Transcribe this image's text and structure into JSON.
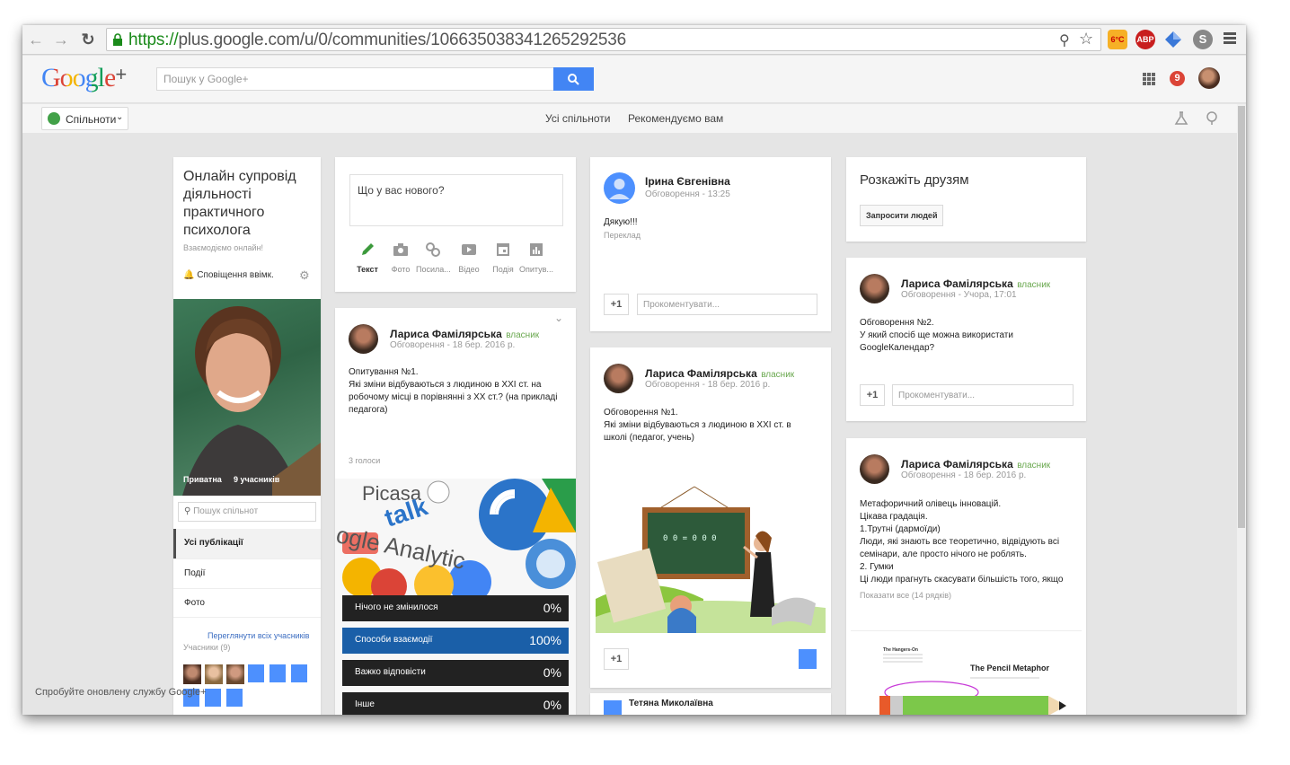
{
  "browser": {
    "url_secure": "https://",
    "url_rest": "plus.google.com/u/0/communities/106635038341265292536",
    "ext_weather": "6°C",
    "ext_abp": "ABP"
  },
  "gbar": {
    "logo_google": "Google",
    "logo_plus": "+",
    "search_placeholder": "Пошук у Google+",
    "notif_count": "9"
  },
  "cbar": {
    "dropdown_label": "Спільноти",
    "link_all": "Усі спільноти",
    "link_recommended": "Рекомендуємо вам"
  },
  "community": {
    "title": "Онлайн супровід діяльності практичного психолога",
    "tagline": "Взаємодіємо онлайн!",
    "notifications": "Сповіщення ввімк.",
    "privacy": "Приватна",
    "members_count": "9 учасників",
    "search_placeholder": "Пошук спільнот",
    "nav": [
      "Усі публікації",
      "Події",
      "Фото"
    ],
    "view_members": "Переглянути всіх учасників",
    "members_label": "Учасники (9)"
  },
  "composer": {
    "prompt": "Що у вас нового?",
    "tools": [
      "Текст",
      "Фото",
      "Посила...",
      "Відео",
      "Подія",
      "Опитув..."
    ]
  },
  "post_poll": {
    "author": "Лариса Фамілярська",
    "badge": "власник",
    "category": "Обговорення",
    "date": "18 бер. 2016 р.",
    "text": "Опитування №1.\nЯкі зміни відбуваються з людиною в XXI ст. на робочому місці  в порівнянні з XX ст.? (на прикладі педагога)",
    "votes": "3 голоси",
    "image_words": [
      "Picasa",
      "talk",
      "ogle Analytic",
      "Google"
    ],
    "options": [
      {
        "label": "Нічого не змінилося",
        "percent": "0%"
      },
      {
        "label": "Способи взаємодії",
        "percent": "100%"
      },
      {
        "label": "Важко відповісти",
        "percent": "0%"
      },
      {
        "label": "Інше",
        "percent": "0%"
      }
    ]
  },
  "post_iryna": {
    "author": "Ірина Євгенівна",
    "category": "Обговорення",
    "time": "13:25",
    "text": "Дякую!!!",
    "translate": "Переклад",
    "plus_one": "+1",
    "comment_placeholder": "Прокоментувати..."
  },
  "post_discussion1": {
    "author": "Лариса Фамілярська",
    "badge": "власник",
    "category": "Обговорення",
    "date": "18 бер. 2016 р.",
    "text": "Обговорення №1.\nЯкі зміни відбуваються з людиною в XXI ст. в школі (педагог, учень)",
    "plus_one": "+1"
  },
  "post_tetiana": {
    "author": "Тетяна Миколаївна"
  },
  "invite": {
    "title": "Розкажіть друзям",
    "button": "Запросити людей"
  },
  "post_discussion2": {
    "author": "Лариса Фамілярська",
    "badge": "власник",
    "category": "Обговорення",
    "date": "Учора, 17:01",
    "text": "Обговорення №2.\nУ який спосіб ще можна використати GoogleКалендар?",
    "plus_one": "+1",
    "comment_placeholder": "Прокоментувати..."
  },
  "post_pencil": {
    "author": "Лариса Фамілярська",
    "badge": "власник",
    "category": "Обговорення",
    "date": "18 бер. 2016 р.",
    "text": "Метафоричний олівець інновацій.\nЦікава градація.\n1.Трутні (дармоїди)\nЛюди, які знають все теоретично, відвідують всі семінари, але просто нічого не роблять.\n2. Гумки\nЦі люди прагнуть скасувати більшість того, якщо",
    "show_all": "Показати все (14 рядків)",
    "image_title": "The Pencil Metaphor",
    "image_subtitle": "The Hangers-On"
  },
  "footer_toast": "Спробуйте оновлену службу Google+",
  "colors": {
    "google_blue": "#4285f4",
    "owner_green": "#6aa84f",
    "poll_selected": "#1a5fa8",
    "notif_red": "#db4437"
  }
}
